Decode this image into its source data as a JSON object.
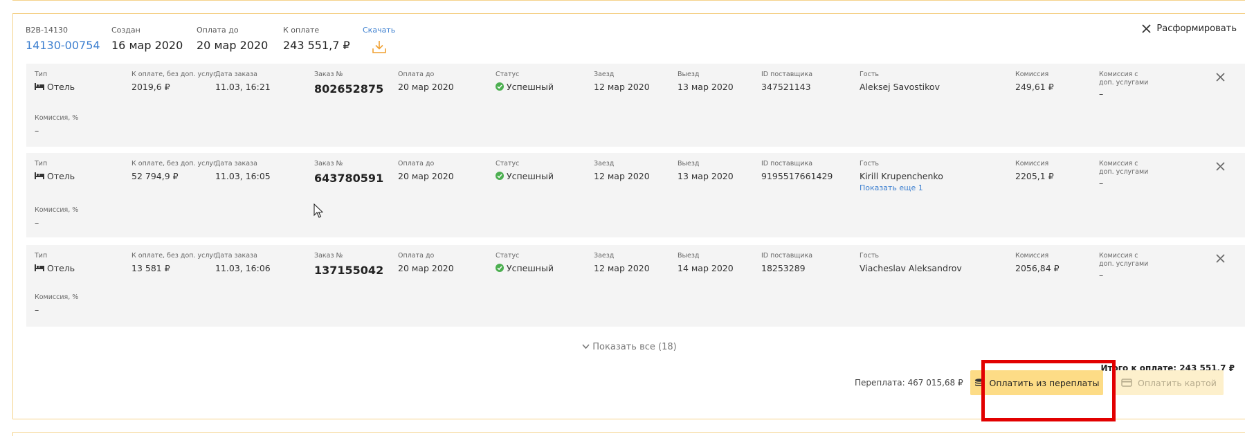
{
  "invoice": {
    "b2b_label": "B2B-14130",
    "number": "14130-00754",
    "created_label": "Создан",
    "created_value": "16 мар 2020",
    "payment_due_label": "Оплата до",
    "payment_due_value": "20 мар 2020",
    "to_pay_label": "К оплате",
    "to_pay_value": "243 551,7 ₽",
    "download_label": "Скачать",
    "disband_label": "Расформировать"
  },
  "labels": {
    "type": "Тип",
    "amount_no_extras": "К оплате, без доп. услуг",
    "order_date": "Дата заказа",
    "order_no": "Заказ №",
    "payment_due": "Оплата до",
    "status": "Статус",
    "check_in": "Заезд",
    "check_out": "Выезд",
    "supplier_id": "ID поставщика",
    "guest": "Гость",
    "commission": "Комиссия",
    "commission_extras": "Комиссия с доп. услугами",
    "commission_pct": "Комиссия, %"
  },
  "orders": [
    {
      "type": "Отель",
      "amount": "2019,6 ₽",
      "order_date": "11.03, 16:21",
      "order_no": "802652875",
      "payment_due": "20 мар 2020",
      "status": "Успешный",
      "check_in": "12 мар 2020",
      "check_out": "13 мар 2020",
      "supplier_id": "347521143",
      "guest": "Aleksej Savostikov",
      "show_more": "",
      "commission": "249,61 ₽",
      "commission_extras": "–",
      "commission_pct": "–"
    },
    {
      "type": "Отель",
      "amount": "52 794,9 ₽",
      "order_date": "11.03, 16:05",
      "order_no": "643780591",
      "payment_due": "20 мар 2020",
      "status": "Успешный",
      "check_in": "12 мар 2020",
      "check_out": "13 мар 2020",
      "supplier_id": "9195517661429",
      "guest": "Kirill Krupenchenko",
      "show_more": "Показать еще 1",
      "commission": "2205,1 ₽",
      "commission_extras": "–",
      "commission_pct": "–"
    },
    {
      "type": "Отель",
      "amount": "13 581 ₽",
      "order_date": "11.03, 16:06",
      "order_no": "137155042",
      "payment_due": "20 мар 2020",
      "status": "Успешный",
      "check_in": "12 мар 2020",
      "check_out": "14 мар 2020",
      "supplier_id": "18253289",
      "guest": "Viacheslav Aleksandrov",
      "show_more": "",
      "commission": "2056,84 ₽",
      "commission_extras": "–",
      "commission_pct": "–"
    }
  ],
  "footer": {
    "show_all": "Показать все (18)",
    "total": "Итого к оплате: 243 551,7 ₽",
    "overpayment": "Переплата: 467 015,68 ₽",
    "pay_overpayment": "Оплатить из переплаты",
    "pay_card": "Оплатить картой"
  },
  "colors": {
    "accent_link": "#3b7ecf",
    "card_border": "#f5d28a",
    "pay_button": "#fddc86",
    "pay_button_disabled": "#fdf0cc",
    "success": "#4caf50",
    "highlight": "#e20000",
    "download_icon": "#f0a030"
  },
  "icons": {
    "download": "download-icon",
    "close": "close-icon",
    "bed": "bed-icon",
    "status_ok": "check-circle-icon",
    "chevron": "chevron-down-icon",
    "coins": "coins-icon",
    "card": "credit-card-icon"
  }
}
